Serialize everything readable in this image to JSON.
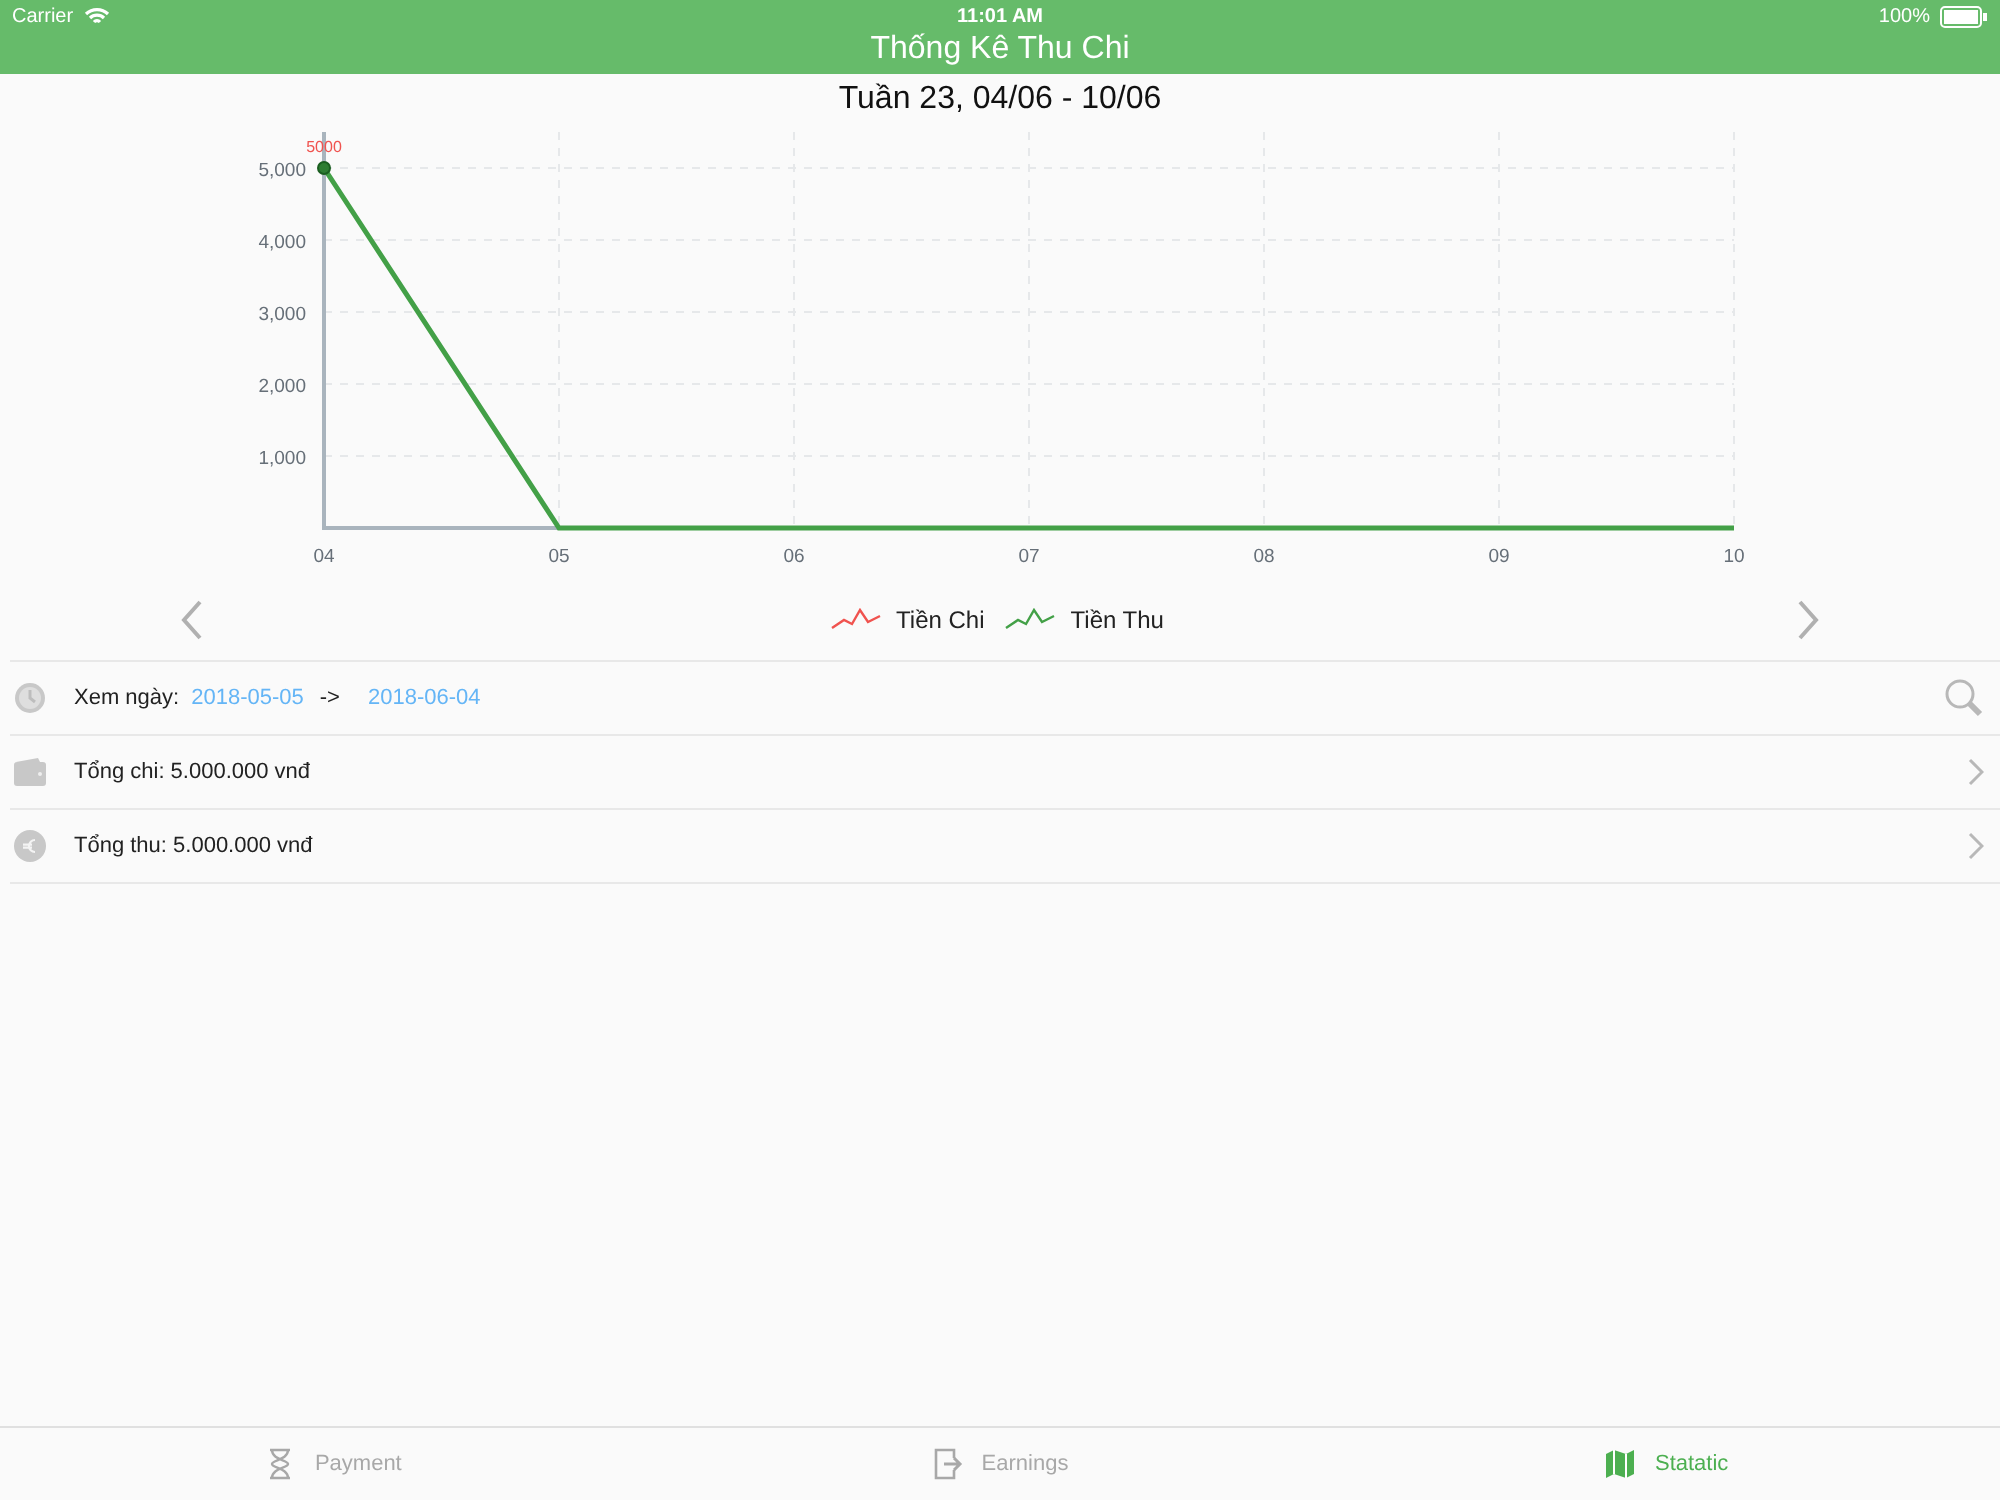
{
  "status_bar": {
    "carrier": "Carrier",
    "time": "11:01 AM",
    "battery": "100%"
  },
  "nav_bar": {
    "title": "Thống Kê Thu Chi"
  },
  "week_title": "Tuần 23, 04/06 - 10/06",
  "chart": {
    "chart_data": {
      "type": "line",
      "categories": [
        "04",
        "05",
        "06",
        "07",
        "08",
        "09",
        "10"
      ],
      "series": [
        {
          "name": "Tiền Chi",
          "color": "#f0534f",
          "values": [
            null,
            null,
            null,
            null,
            null,
            null,
            null
          ]
        },
        {
          "name": "Tiền Thu",
          "color": "#43a047",
          "values": [
            5000,
            0,
            0,
            0,
            0,
            0,
            0
          ]
        }
      ],
      "grid": true,
      "ylim": [
        0,
        5500
      ],
      "yticks": [
        {
          "value": 1000,
          "label": "1,000"
        },
        {
          "value": 2000,
          "label": "2,000"
        },
        {
          "value": 3000,
          "label": "3,000"
        },
        {
          "value": 4000,
          "label": "4,000"
        },
        {
          "value": 5000,
          "label": "5,000"
        }
      ],
      "annotations": [
        {
          "x": "04",
          "y": 5000,
          "text": "5000"
        }
      ]
    }
  },
  "date_row": {
    "label": "Xem ngày:",
    "from": "2018-05-05",
    "arrow": "->",
    "to": "2018-06-04"
  },
  "summary_rows": [
    {
      "kind": "wallet",
      "text": "Tổng chi: 5.000.000 vnđ"
    },
    {
      "kind": "euro",
      "text": "Tổng thu: 5.000.000 vnđ"
    }
  ],
  "tabs": [
    {
      "kind": "hourglass",
      "label": "Payment",
      "selected": false
    },
    {
      "kind": "exit",
      "label": "Earnings",
      "selected": false
    },
    {
      "kind": "map",
      "label": "Statatic",
      "selected": true
    }
  ]
}
